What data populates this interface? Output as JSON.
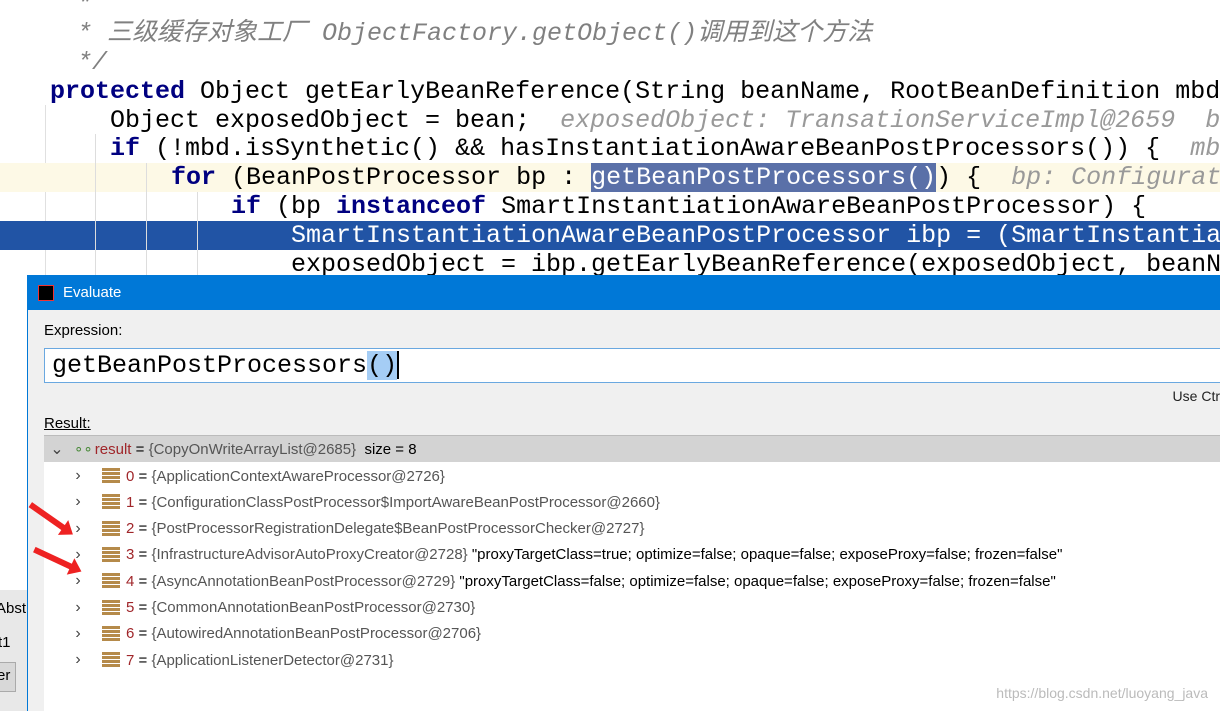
{
  "editor": {
    "lines": [
      {
        "text": " *"
      },
      {
        "text": " * 三级缓存对象工厂 ObjectFactory.getObject()调用到这个方法"
      },
      {
        "text": " */"
      },
      {
        "kw": "protected",
        "text": " Object getEarlyBeanReference(String beanName, RootBeanDefinition mbd"
      },
      {
        "text": "Object exposedObject = bean;",
        "hint": "exposedObject: TransationServiceImpl@2659  b"
      },
      {
        "kw": "if",
        "text": " (!mbd.isSynthetic() && hasInstantiationAwareBeanPostProcessors()) {",
        "hint": "mb"
      },
      {
        "kw": "for",
        "pre": " (BeanPostProcessor bp : ",
        "hl": "getBeanPostProcessors()",
        "post": ") {",
        "hint": "bp: Configurat"
      },
      {
        "kw": "if",
        "pre": " (bp ",
        "kw2": "instanceof",
        "post": " SmartInstantiationAwareBeanPostProcessor) {"
      },
      {
        "text": "SmartInstantiationAwareBeanPostProcessor ibp = (SmartInstantia"
      },
      {
        "text": "exposedObject = ibp.getEarlyBeanReference(exposedObject, beanN"
      }
    ]
  },
  "dialog": {
    "title": "Evaluate",
    "app_icon": "IJ",
    "expression_label": "Expression:",
    "expression_text": "getBeanPostProcessors",
    "expression_parens": "()",
    "use_ctrl_hint": "Use Ctr",
    "result_label": "Result:",
    "result": {
      "name": "result",
      "eq": " = ",
      "value": "{CopyOnWriteArrayList@2685}",
      "size": "  size = 8"
    },
    "items": [
      {
        "index": "0",
        "value": "{ApplicationContextAwareProcessor@2726}",
        "desc": ""
      },
      {
        "index": "1",
        "value": "{ConfigurationClassPostProcessor$ImportAwareBeanPostProcessor@2660}",
        "desc": ""
      },
      {
        "index": "2",
        "value": "{PostProcessorRegistrationDelegate$BeanPostProcessorChecker@2727}",
        "desc": ""
      },
      {
        "index": "3",
        "value": "{InfrastructureAdvisorAutoProxyCreator@2728}",
        "desc": " \"proxyTargetClass=true; optimize=false; opaque=false; exposeProxy=false; frozen=false\""
      },
      {
        "index": "4",
        "value": "{AsyncAnnotationBeanPostProcessor@2729}",
        "desc": " \"proxyTargetClass=false; optimize=false; opaque=false; exposeProxy=false; frozen=false\""
      },
      {
        "index": "5",
        "value": "{CommonAnnotationBeanPostProcessor@2730}",
        "desc": ""
      },
      {
        "index": "6",
        "value": "{AutowiredAnnotationBeanPostProcessor@2706}",
        "desc": ""
      },
      {
        "index": "7",
        "value": "{ApplicationListenerDetector@2731}",
        "desc": ""
      }
    ]
  },
  "left_tabs": [
    "Abst",
    "t1",
    "er"
  ],
  "watermark": "https://blog.csdn.net/luoyang_java"
}
